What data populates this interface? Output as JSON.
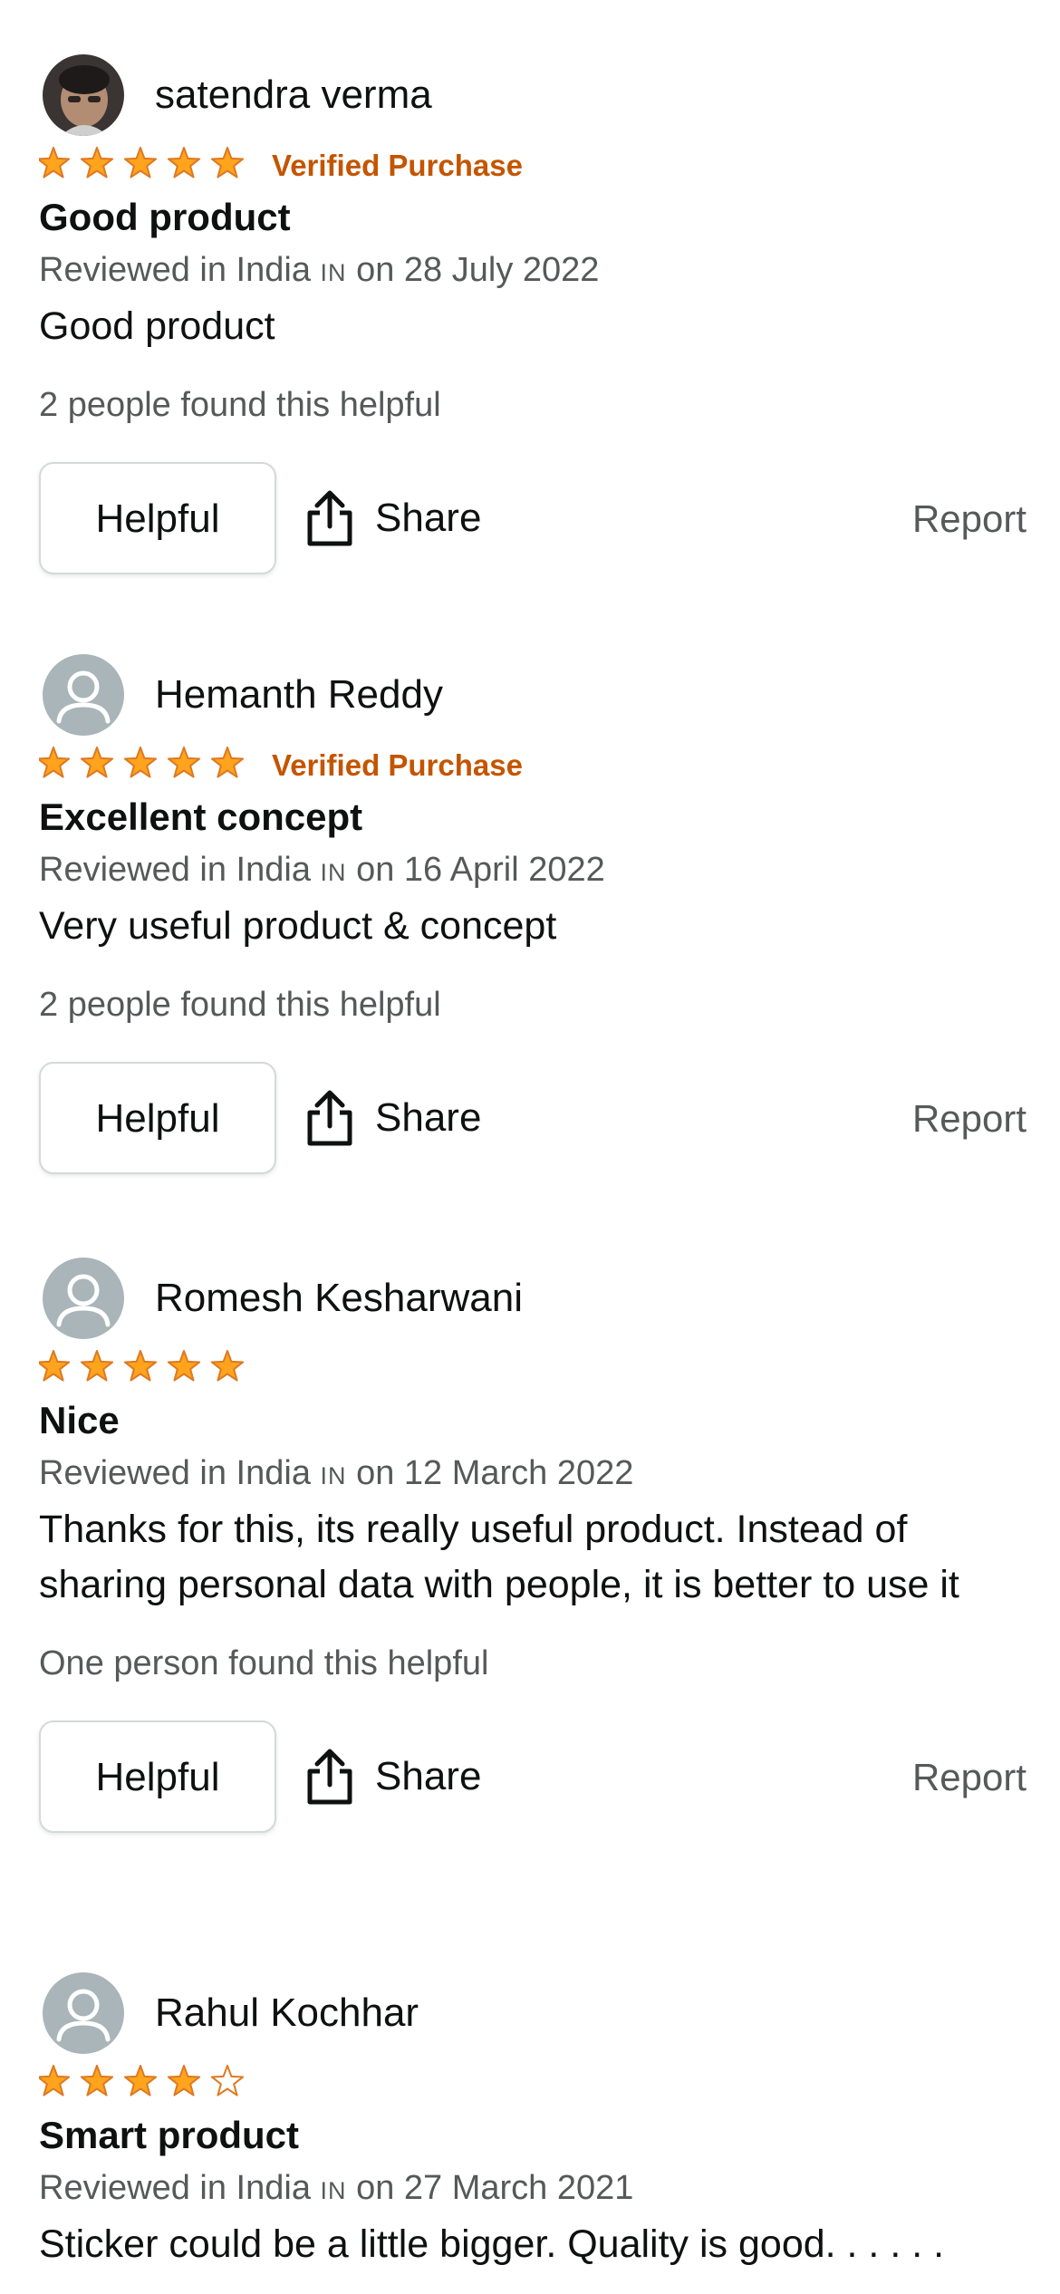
{
  "reviews": [
    {
      "name": "satendra verma",
      "avatar": "user-photo",
      "rating": 5,
      "verified": "Verified Purchase",
      "title": "Good product",
      "reviewed_prefix": "Reviewed in India",
      "flag": "IN",
      "reviewed_suffix": "on 28 July 2022",
      "body": "Good product",
      "helpful_count": "2 people found this helpful",
      "helpful_label": "Helpful",
      "share_label": "Share",
      "report_label": "Report"
    },
    {
      "name": "Hemanth Reddy",
      "avatar": "default-user-icon",
      "rating": 5,
      "verified": "Verified Purchase",
      "title": "Excellent concept",
      "reviewed_prefix": "Reviewed in India",
      "flag": "IN",
      "reviewed_suffix": "on 16 April 2022",
      "body": "Very useful product & concept",
      "helpful_count": "2 people found this helpful",
      "helpful_label": "Helpful",
      "share_label": "Share",
      "report_label": "Report"
    },
    {
      "name": "Romesh Kesharwani",
      "avatar": "default-user-icon",
      "rating": 5,
      "title": "Nice",
      "reviewed_prefix": "Reviewed in India",
      "flag": "IN",
      "reviewed_suffix": "on 12 March 2022",
      "body": "Thanks for this, its really useful product. Instead of sharing personal data with people, it is better to use it",
      "helpful_count": "One person found this helpful",
      "helpful_label": "Helpful",
      "share_label": "Share",
      "report_label": "Report"
    },
    {
      "name": "Rahul Kochhar",
      "avatar": "default-user-icon",
      "rating": 4,
      "title": "Smart product",
      "reviewed_prefix": "Reviewed in India",
      "flag": "IN",
      "reviewed_suffix": "on 27 March 2021",
      "body": "Sticker could be a little bigger. Quality is good. . . . . ."
    }
  ],
  "colors": {
    "star_fill": "#ffa41c",
    "star_stroke": "#de7921",
    "verified": "#c45500",
    "secondary_text": "#565959",
    "primary_text": "#0f1111",
    "button_border": "#d5d9d9",
    "avatar_bg": "#a9b5b8"
  }
}
